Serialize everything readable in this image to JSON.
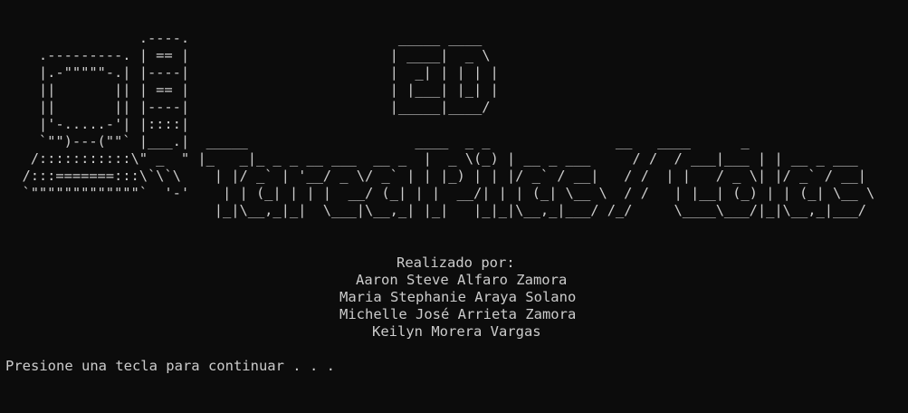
{
  "banner": {
    "lines": [
      "                .----.                         _____ ____",
      "    .---------. | == |                        | ____|  _ \\",
      "    |.-\"\"\"\"\"-.| |----|                        |  _| | | | |",
      "    ||       || | == |                        | |___| |_| |",
      "    ||       || |----|                        |_____|____/",
      "    |'-.....-'| |::::|",
      "    `\"\")---(\"\"` |___.|  _____                    ____  _ _               __   ____      _",
      "   /:::::::::::\\\" _  \" |_   _|_ _ _ __ ___  __ _  |  _ \\(_) | __ _ ___     / /  / ___|___ | | __ _ ___",
      "  /:::=======:::\\`\\`\\    | |/ _` | '__/ _ \\/ _` | | |_) | | |/ _` / __|   / /  | |   / _ \\| |/ _` / __|",
      "  `\"\"\"\"\"\"\"\"\"\"\"\"\"`  '-'    | | (_| | | |  __/ (_| | |  __/| | | (_| \\__ \\  / /   | |__| (_) | | (_| \\__ \\",
      "                         |_|\\__,_|_|  \\___|\\__,_| |_|   |_|_|\\__,_|___/ /_/     \\____\\___/|_|\\__,_|___/"
    ]
  },
  "credits": {
    "heading": "Realizado por:",
    "authors": [
      "Aaron Steve Alfaro Zamora",
      "Maria Stephanie Araya Solano",
      "Michelle José Arrieta Zamora",
      "Keilyn Morera Vargas"
    ]
  },
  "prompt": {
    "text": "Presione una tecla para continuar . . ."
  },
  "colors": {
    "background": "#0c0c0c",
    "foreground": "#cccccc"
  }
}
